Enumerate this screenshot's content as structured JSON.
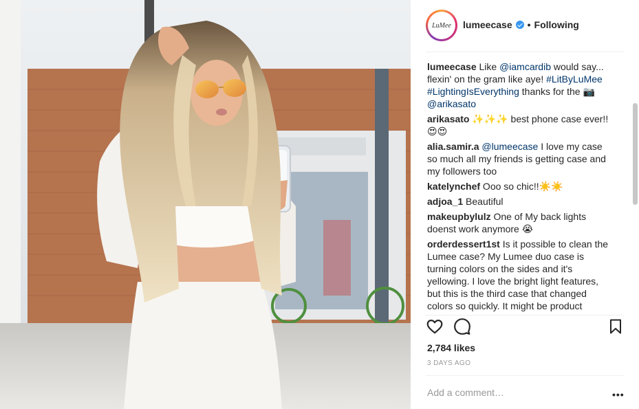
{
  "post": {
    "username": "lumeecase",
    "avatar_text": "LuMee",
    "separator": "•",
    "follow_status": "Following",
    "comments": [
      {
        "user": "lumeecase",
        "parts": [
          {
            "t": " Like "
          },
          {
            "t": "@iamcardib",
            "k": "mention"
          },
          {
            "t": " would say... flexin' on the gram like aye! "
          },
          {
            "t": "#LitByLuMee",
            "k": "tag"
          },
          {
            "t": " "
          },
          {
            "t": "#LightingIsEverything",
            "k": "tag"
          },
          {
            "t": " thanks for the 📷 "
          },
          {
            "t": "@arikasato",
            "k": "mention"
          }
        ]
      },
      {
        "user": "arikasato",
        "parts": [
          {
            "t": " ✨✨✨ best phone case ever!! 😍😍"
          }
        ]
      },
      {
        "user": "alia.samir.a",
        "parts": [
          {
            "t": " "
          },
          {
            "t": "@lumeecase",
            "k": "mention"
          },
          {
            "t": " I love my case so much all my friends is getting case and my followers too"
          }
        ]
      },
      {
        "user": "katelynchef",
        "parts": [
          {
            "t": " Ooo so chic!!☀️☀️"
          }
        ]
      },
      {
        "user": "adjoa_1",
        "parts": [
          {
            "t": " Beautiful"
          }
        ]
      },
      {
        "user": "makeupbylulz",
        "parts": [
          {
            "t": " One of My back lights doenst work anymore 😭"
          }
        ]
      },
      {
        "user": "orderdessert1st",
        "parts": [
          {
            "t": " Is it possible to clean the Lumee case? My Lumee duo case is turning colors on the sides and it's yellowing. I love the bright light features, but this is the third case that changed colors so quickly. It might be product"
          }
        ]
      }
    ],
    "likes": "2,784 likes",
    "posted": "3 DAYS AGO",
    "comment_placeholder": "Add a comment…",
    "more_label": "•••"
  },
  "colors": {
    "link": "#003569",
    "verified": "#3897f0",
    "muted": "#999999"
  },
  "icons": {
    "like": "heart-outline-icon",
    "comment": "speech-bubble-icon",
    "save": "bookmark-icon",
    "verified": "verified-badge-icon"
  }
}
